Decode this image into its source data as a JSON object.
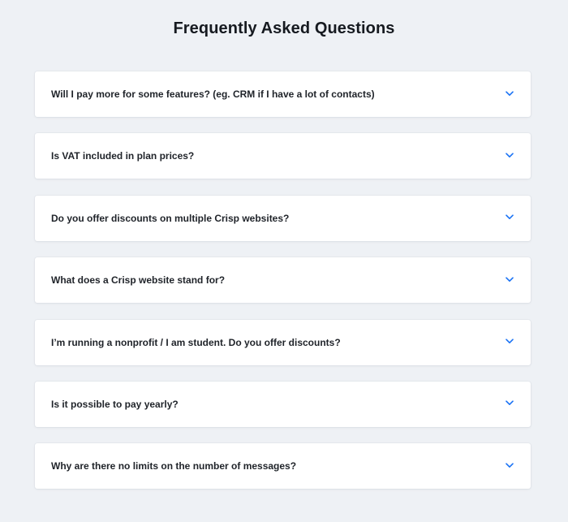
{
  "page": {
    "title": "Frequently Asked Questions"
  },
  "faq": {
    "items": [
      {
        "question": "Will I pay more for some features? (eg. CRM if I have a lot of contacts)",
        "icon": "chevron-down-icon"
      },
      {
        "question": "Is VAT included in plan prices?",
        "icon": "chevron-down-icon"
      },
      {
        "question": "Do you offer discounts on multiple Crisp websites?",
        "icon": "chevron-down-icon"
      },
      {
        "question": "What does a Crisp website stand for?",
        "icon": "chevron-down-icon"
      },
      {
        "question": "I’m running a nonprofit / I am student. Do you offer discounts?",
        "icon": "chevron-down-icon"
      },
      {
        "question": "Is it possible to pay yearly?",
        "icon": "chevron-down-icon"
      },
      {
        "question": "Why are there no limits on the number of messages?",
        "icon": "chevron-down-icon"
      }
    ]
  },
  "colors": {
    "background": "#eef1f5",
    "card": "#ffffff",
    "accent": "#1972f5",
    "text": "#1f2329"
  }
}
